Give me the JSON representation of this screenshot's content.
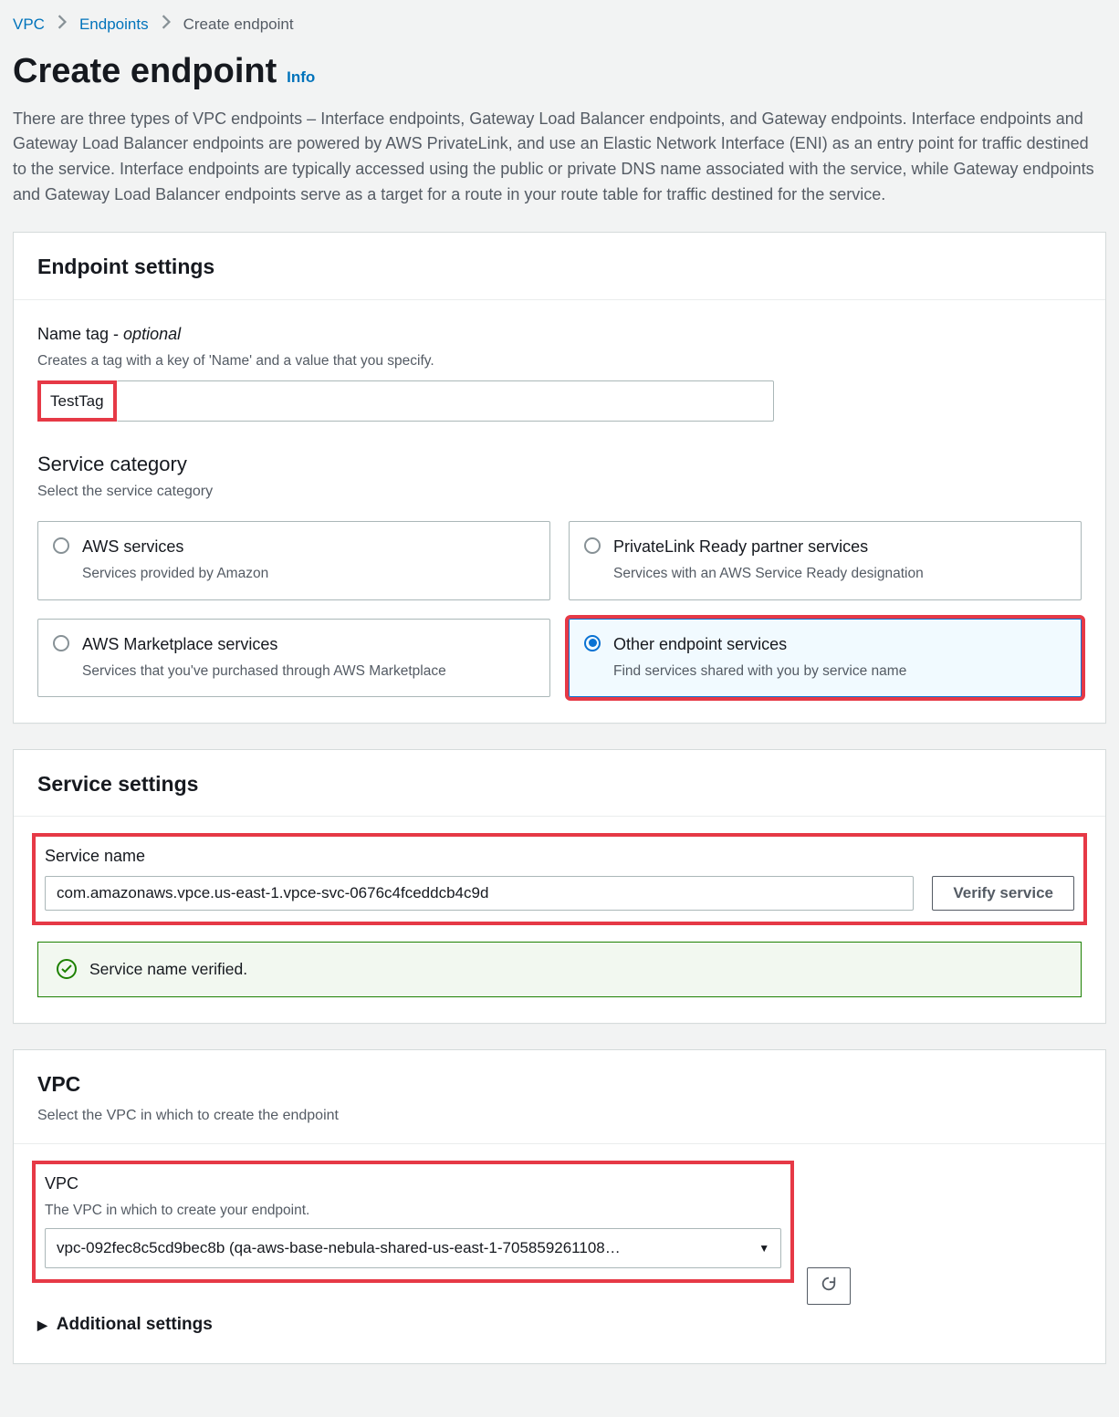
{
  "breadcrumbs": {
    "vpc": "VPC",
    "endpoints": "Endpoints",
    "current": "Create endpoint"
  },
  "header": {
    "title": "Create endpoint",
    "info": "Info",
    "description": "There are three types of VPC endpoints – Interface endpoints, Gateway Load Balancer endpoints, and Gateway endpoints. Interface endpoints and Gateway Load Balancer endpoints are powered by AWS PrivateLink, and use an Elastic Network Interface (ENI) as an entry point for traffic destined to the service. Interface endpoints are typically accessed using the public or private DNS name associated with the service, while Gateway endpoints and Gateway Load Balancer endpoints serve as a target for a route in your route table for traffic destined for the service."
  },
  "endpoint_settings": {
    "panel_title": "Endpoint settings",
    "name_tag_label": "Name tag - ",
    "name_tag_optional": "optional",
    "name_tag_hint": "Creates a tag with a key of 'Name' and a value that you specify.",
    "name_tag_value": "TestTag",
    "service_category_label": "Service category",
    "service_category_hint": "Select the service category",
    "options": [
      {
        "title": "AWS services",
        "desc": "Services provided by Amazon",
        "selected": false
      },
      {
        "title": "PrivateLink Ready partner services",
        "desc": "Services with an AWS Service Ready designation",
        "selected": false
      },
      {
        "title": "AWS Marketplace services",
        "desc": "Services that you've purchased through AWS Marketplace",
        "selected": false
      },
      {
        "title": "Other endpoint services",
        "desc": "Find services shared with you by service name",
        "selected": true
      }
    ]
  },
  "service_settings": {
    "panel_title": "Service settings",
    "service_name_label": "Service name",
    "service_name_value": "com.amazonaws.vpce.us-east-1.vpce-svc-0676c4fceddcb4c9d",
    "verify_button": "Verify service",
    "verified_message": "Service name verified."
  },
  "vpc": {
    "panel_title": "VPC",
    "panel_sub": "Select the VPC in which to create the endpoint",
    "field_label": "VPC",
    "field_hint": "The VPC in which to create your endpoint.",
    "selected_value": "vpc-092fec8c5cd9bec8b (qa-aws-base-nebula-shared-us-east-1-705859261108…",
    "refresh_icon": "refresh",
    "additional_settings": "Additional settings"
  }
}
